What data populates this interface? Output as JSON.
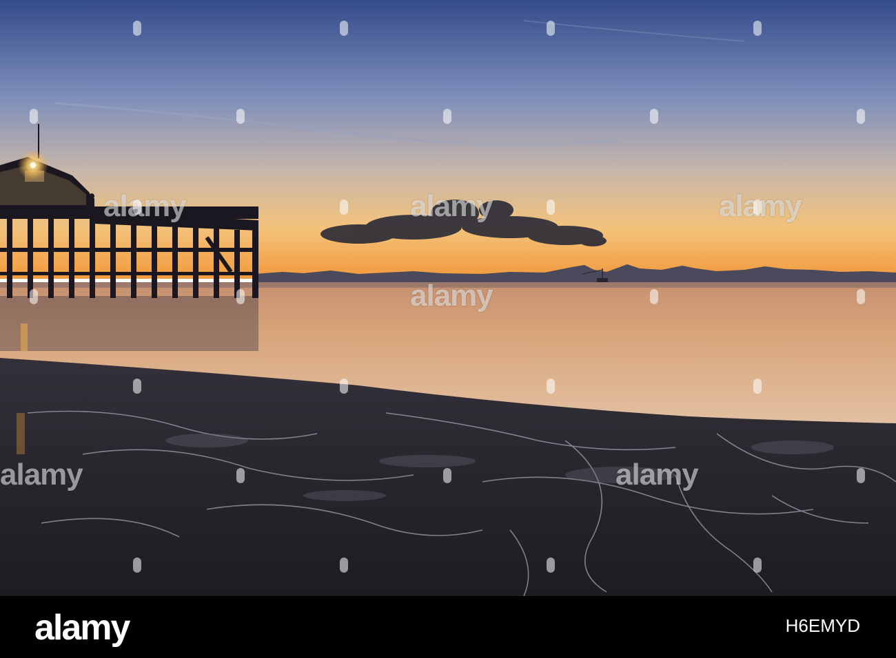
{
  "photo": {
    "subject": "sunset-pier-beach-scene",
    "colors": {
      "sky_top": "#3e5490",
      "sky_mid": "#8898b8",
      "horizon_glow": "#f7a64a",
      "water": "#d9a779",
      "sand": "#2b2a31"
    }
  },
  "watermark": {
    "word": "alamy"
  },
  "footer": {
    "logo": "alamy",
    "image_id": "H6EMYD"
  }
}
